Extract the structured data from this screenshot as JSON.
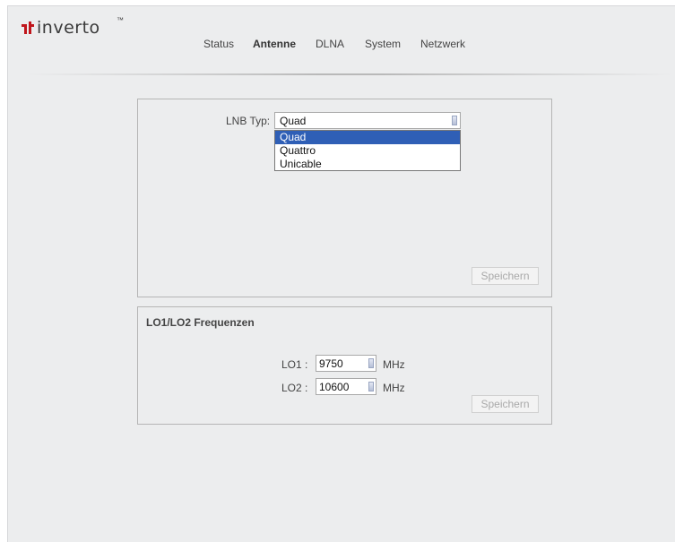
{
  "logo": {
    "text": "inverto",
    "tm": "™",
    "brand_color": "#c0161c"
  },
  "nav": {
    "items": [
      "Status",
      "Antenne",
      "DLNA",
      "System",
      "Netzwerk"
    ],
    "active": "Antenne"
  },
  "lnb_panel": {
    "label": "LNB Typ:",
    "selected": "Quad",
    "options": [
      "Quad",
      "Quattro",
      "Unicable"
    ],
    "save_label": "Speichern"
  },
  "lo_panel": {
    "title": "LO1/LO2 Frequenzen",
    "lo1": {
      "label": "LO1 :",
      "value": "9750",
      "unit": "MHz"
    },
    "lo2": {
      "label": "LO2 :",
      "value": "10600",
      "unit": "MHz"
    },
    "save_label": "Speichern"
  }
}
